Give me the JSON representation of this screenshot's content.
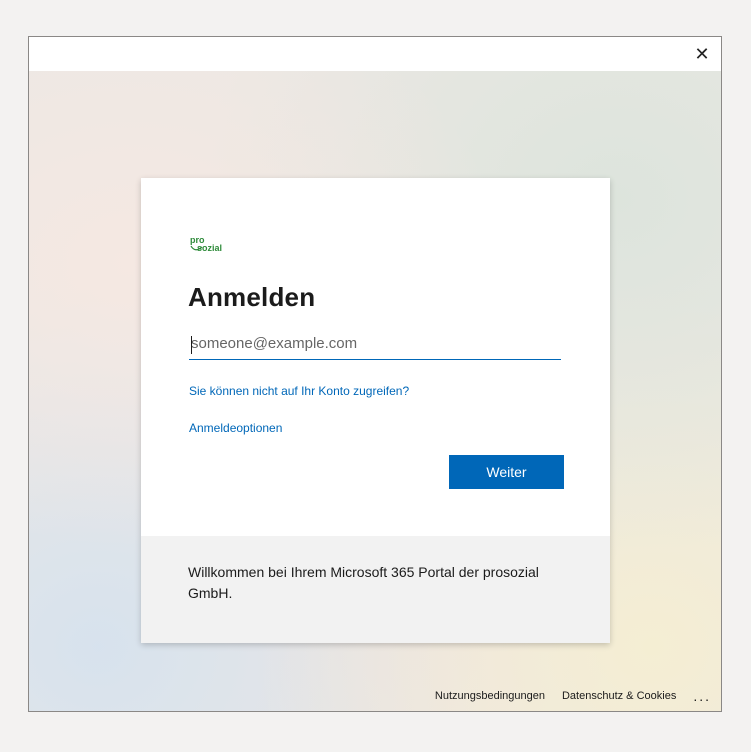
{
  "window": {
    "close_glyph": "✕"
  },
  "card": {
    "logo_text_top": "pro",
    "logo_text_bottom": "sozial",
    "logo_color": "#2e8b3a",
    "title": "Anmelden",
    "email_placeholder": "someone@example.com",
    "email_value": "",
    "link_no_access": "Sie können nicht auf Ihr Konto zugreifen?",
    "link_signin_options": "Anmeldeoptionen",
    "next_button_label": "Weiter",
    "accent_color": "#0067b8"
  },
  "footer_message": "Willkommen bei Ihrem Microsoft 365 Portal der prosozial GmbH.",
  "page_footer": {
    "terms_label": "Nutzungsbedingungen",
    "privacy_label": "Datenschutz & Cookies",
    "more_label": "..."
  }
}
